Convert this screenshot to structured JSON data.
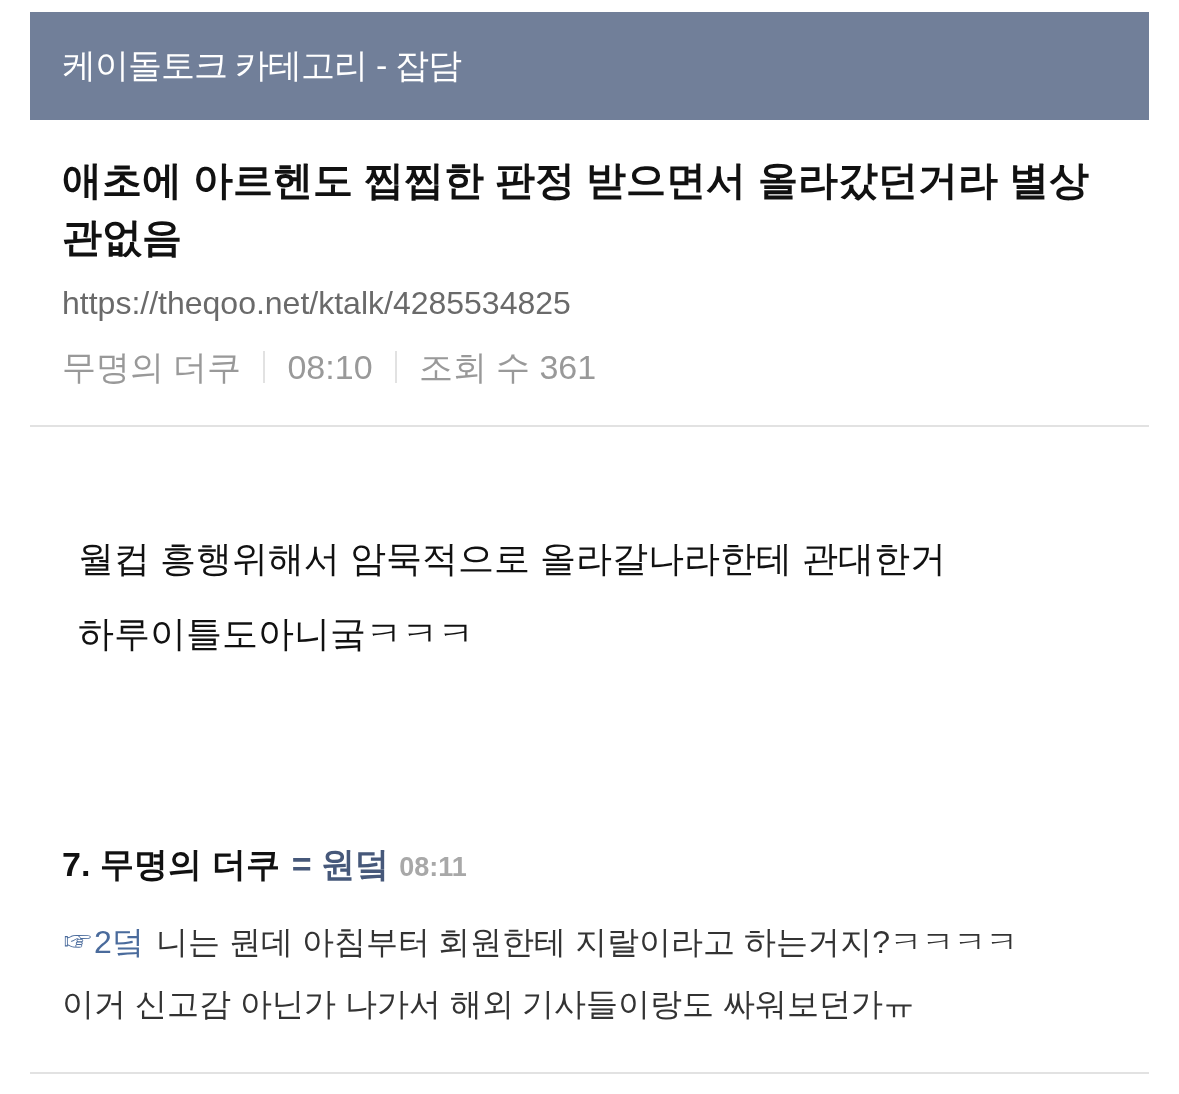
{
  "header": {
    "title": "케이돌토크 카테고리 - 잡담"
  },
  "post": {
    "title": "애초에 아르헨도 찝찝한 판정 받으면서 올라갔던거라 별상 관없음",
    "url": "https://theqoo.net/ktalk/4285534825",
    "author": "무명의 더쿠",
    "time": "08:10",
    "views": "조회 수 361"
  },
  "body": {
    "lines": [
      "월컵 흥행위해서 암묵적으로 올라갈나라한테 관대한거",
      "하루이틀도아니궄ㅋㅋㅋ"
    ]
  },
  "comments": [
    {
      "number": "7.",
      "author": "무명의 더쿠",
      "tag": "= 원덬",
      "time": "08:11",
      "mention": "☞2덬",
      "lines": [
        "니는 뭔데 아침부터 회원한테 지랄이라고 하는거지?ㅋㅋㅋㅋ",
        "이거 신고감 아닌가 나가서 해외 기사들이랑도 싸워보던가ㅠ"
      ]
    }
  ]
}
